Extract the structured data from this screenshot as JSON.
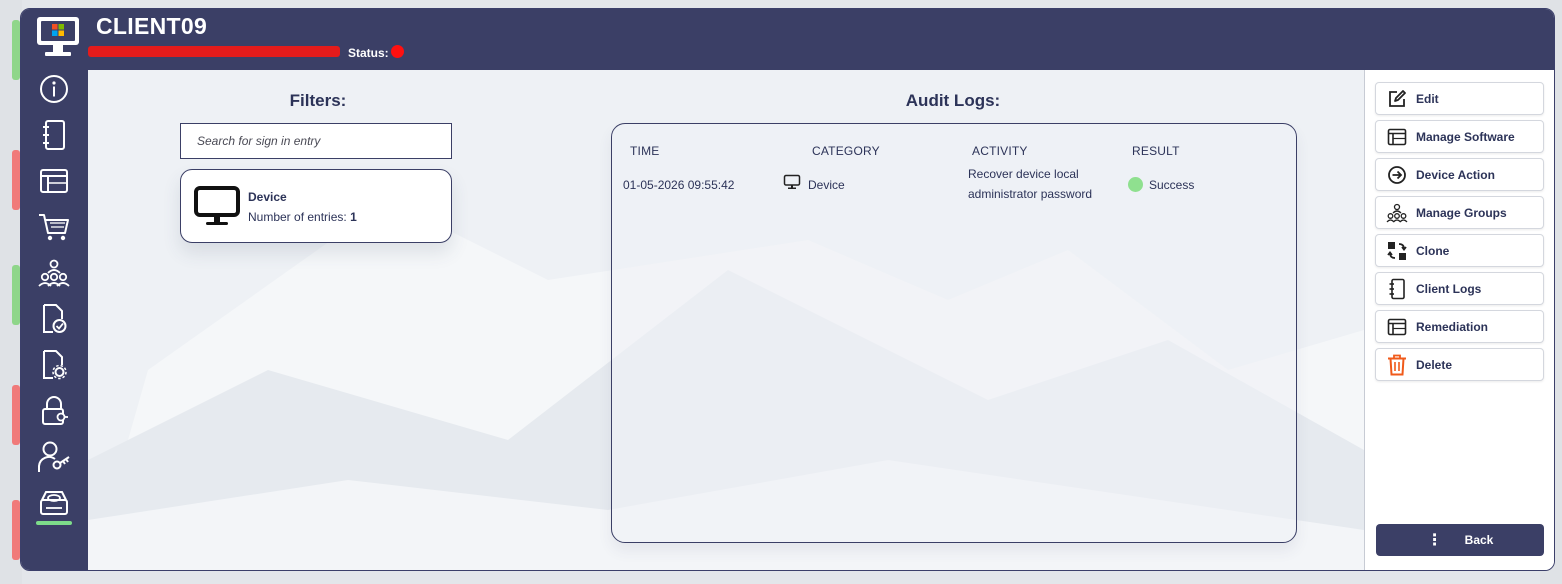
{
  "header": {
    "client_name": "CLIENT09",
    "status_label": "Status:",
    "status_color": "#ff1010"
  },
  "sidebar": {
    "items": [
      {
        "name": "info-icon"
      },
      {
        "name": "notebook-icon"
      },
      {
        "name": "window-table-icon"
      },
      {
        "name": "cart-icon"
      },
      {
        "name": "groups-icon"
      },
      {
        "name": "document-check-icon"
      },
      {
        "name": "document-gear-icon"
      },
      {
        "name": "lock-key-icon"
      },
      {
        "name": "user-key-icon"
      },
      {
        "name": "disk-icon",
        "active": true
      }
    ],
    "active_color": "#7ddc8a"
  },
  "filters": {
    "title": "Filters:",
    "search_placeholder": "Search for sign in entry",
    "cards": [
      {
        "title": "Device",
        "entries_label": "Number of entries:",
        "entries_count": "1"
      }
    ]
  },
  "audit": {
    "title": "Audit Logs:",
    "columns": [
      "TIME",
      "CATEGORY",
      "ACTIVITY",
      "RESULT"
    ],
    "rows": [
      {
        "time": "01-05-2026 09:55:42",
        "category": "Device",
        "activity_line1": "Recover device local",
        "activity_line2": "administrator password",
        "result": "Success",
        "result_color": "#8fe08f"
      }
    ]
  },
  "actions": {
    "buttons": [
      {
        "label": "Edit",
        "icon": "edit-icon"
      },
      {
        "label": "Manage Software",
        "icon": "window-table-icon"
      },
      {
        "label": "Device Action",
        "icon": "arrow-circle-icon"
      },
      {
        "label": "Manage Groups",
        "icon": "groups-icon"
      },
      {
        "label": "Clone",
        "icon": "clone-icon"
      },
      {
        "label": "Client Logs",
        "icon": "notebook-icon"
      },
      {
        "label": "Remediation",
        "icon": "window-table-icon"
      },
      {
        "label": "Delete",
        "icon": "trash-icon"
      }
    ],
    "back_label": "Back",
    "delete_color": "#f05a1a"
  }
}
